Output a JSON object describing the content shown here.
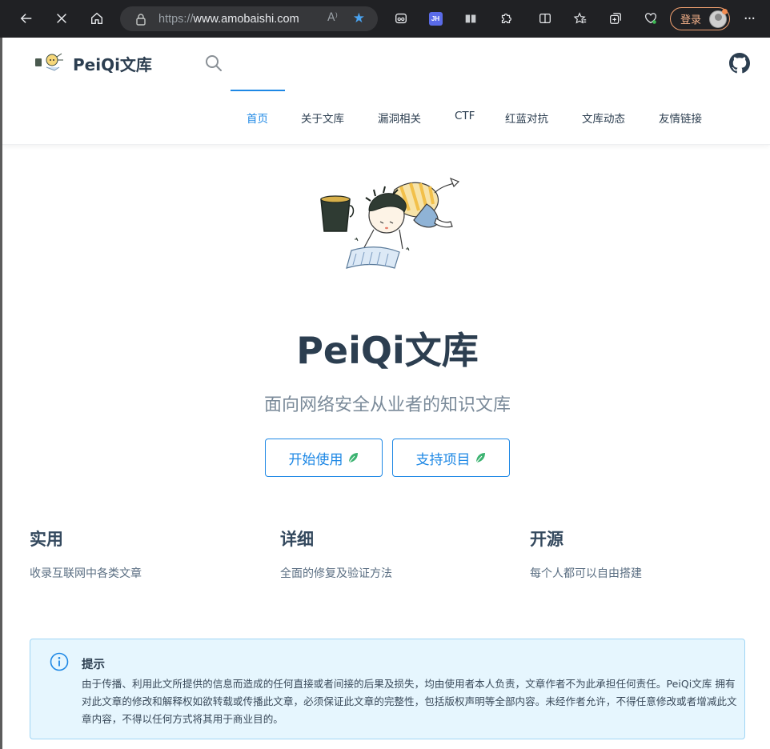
{
  "browser": {
    "url_prefix": "https://",
    "url_host": "www.amobaishi.com",
    "read_aloud": "A⁾",
    "jh_label": "JH",
    "login_label": "登录",
    "more_label": "···"
  },
  "site": {
    "name": "PeiQi文库"
  },
  "nav": {
    "items": [
      "首页",
      "关于文库",
      "漏洞相关",
      "CTF",
      "红蓝对抗",
      "文库动态",
      "友情链接"
    ],
    "active_index": 0
  },
  "hero": {
    "title": "PeiQi文库",
    "description": "面向网络安全从业者的知识文库",
    "buttons": [
      "开始使用",
      "支持项目"
    ]
  },
  "features": [
    {
      "title": "实用",
      "details": "收录互联网中各类文章"
    },
    {
      "title": "详细",
      "details": "全面的修复及验证方法"
    },
    {
      "title": "开源",
      "details": "每个人都可以自由搭建"
    }
  ],
  "tip": {
    "title": "提示",
    "text": "由于传播、利用此文所提供的信息而造成的任何直接或者间接的后果及损失，均由使用者本人负责，文章作者不为此承担任何责任。PeiQi文库 拥有对此文章的修改和解释权如欲转载或传播此文章，必须保证此文章的完整性，包括版权声明等全部内容。未经作者允许，不得任意修改或者增减此文章内容，不得以任何方式将其用于商业目的。"
  },
  "colors": {
    "accent": "#1e88e5",
    "chrome_bg": "#202124",
    "tip_bg": "#e6f6fe",
    "tip_border": "#a0d6f5"
  }
}
